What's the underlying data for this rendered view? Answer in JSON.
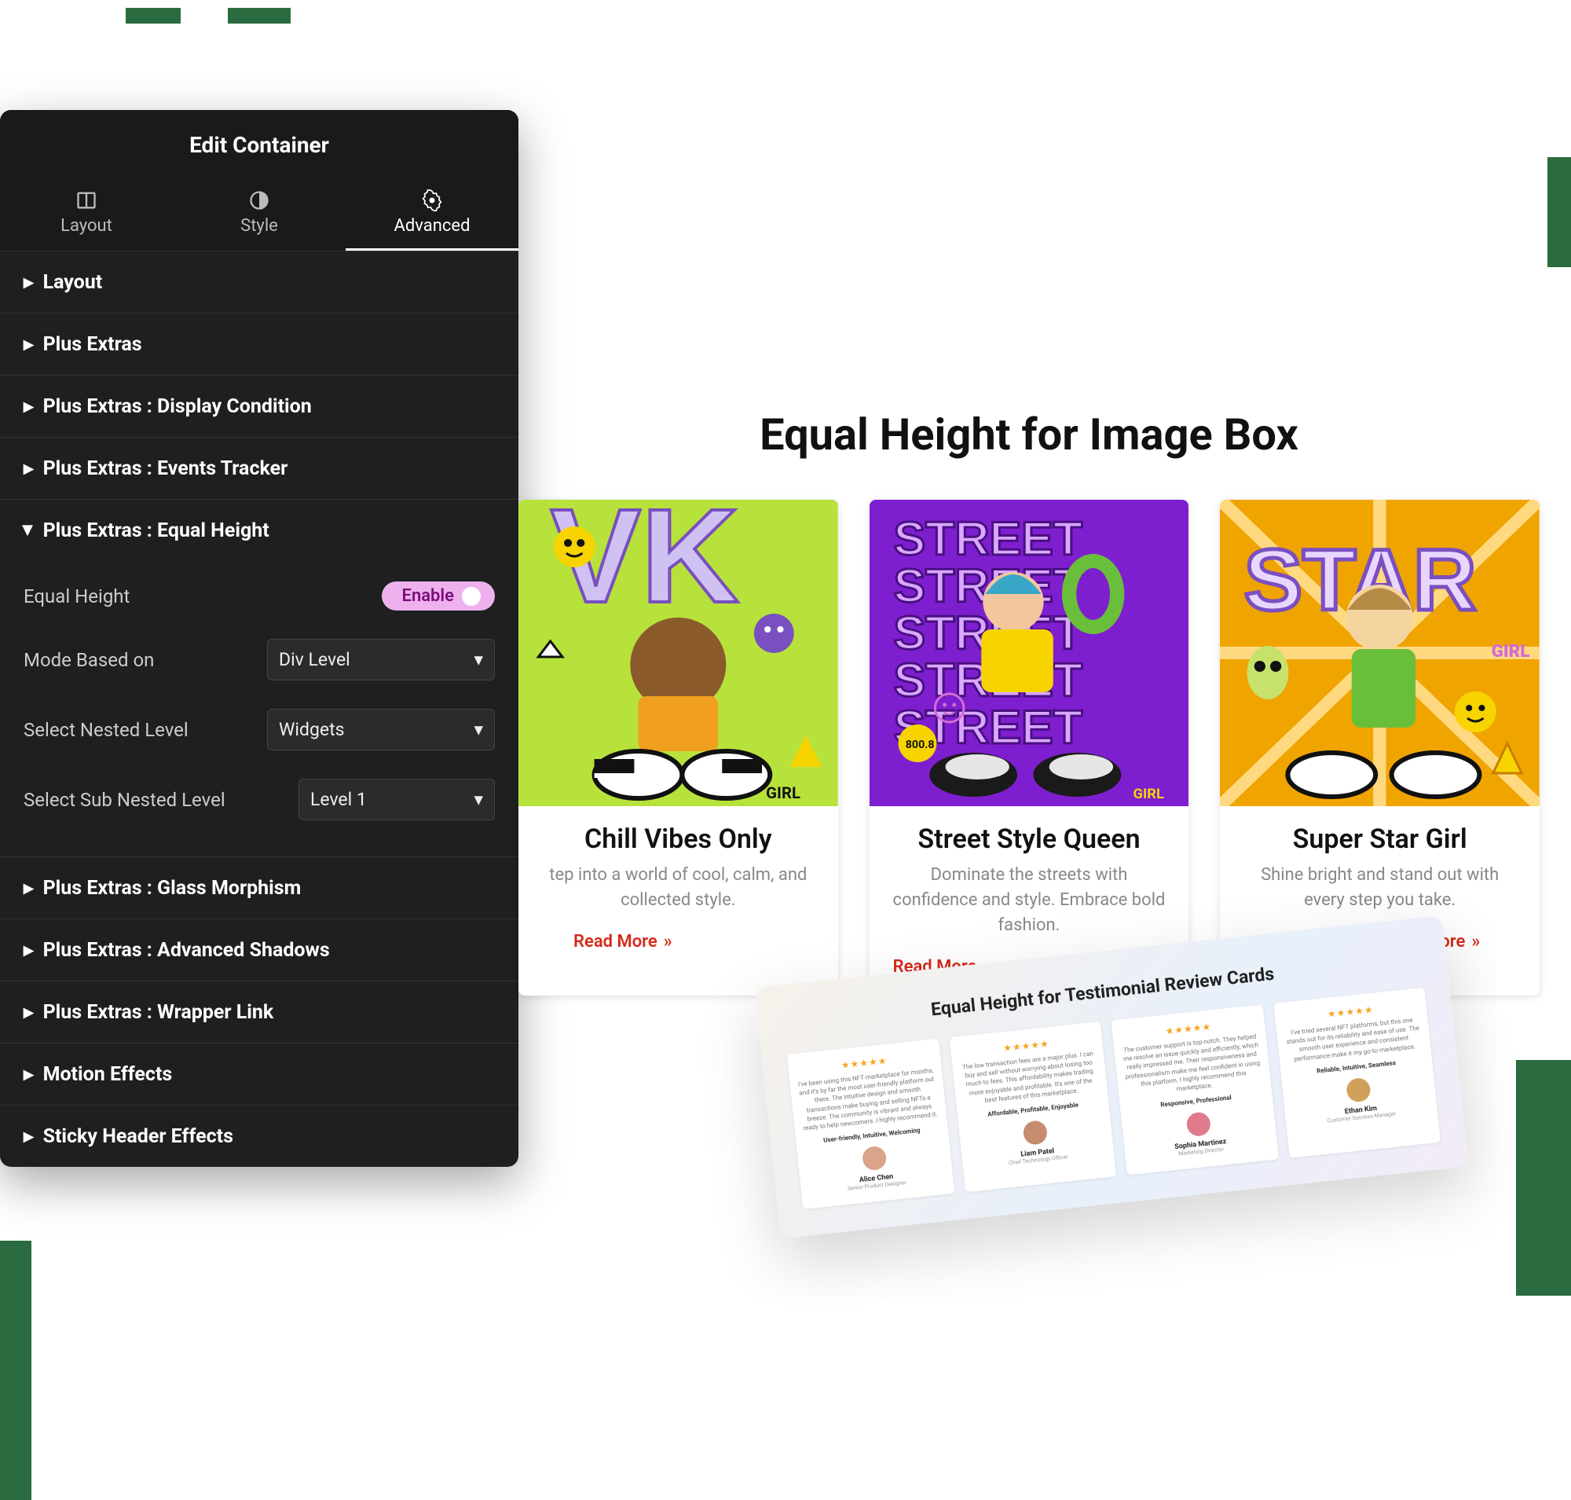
{
  "panel": {
    "title": "Edit Container",
    "tabs": [
      {
        "label": "Layout",
        "icon": "layout-icon",
        "active": false
      },
      {
        "label": "Style",
        "icon": "contrast-icon",
        "active": false
      },
      {
        "label": "Advanced",
        "icon": "gear-icon",
        "active": true
      }
    ],
    "sections": [
      {
        "label": "Layout",
        "open": false
      },
      {
        "label": "Plus Extras",
        "open": false
      },
      {
        "label": "Plus Extras : Display Condition",
        "open": false
      },
      {
        "label": "Plus Extras : Events Tracker",
        "open": false
      },
      {
        "label": "Plus Extras : Equal Height",
        "open": true,
        "fields": {
          "equal_height_label": "Equal Height",
          "equal_height_toggle": "Enable",
          "mode_label": "Mode Based on",
          "mode_value": "Div Level",
          "nested_label": "Select Nested Level",
          "nested_value": "Widgets",
          "sub_label": "Select Sub Nested Level",
          "sub_value": "Level 1"
        }
      },
      {
        "label": "Plus Extras : Glass Morphism",
        "open": false
      },
      {
        "label": "Plus Extras : Advanced Shadows",
        "open": false
      },
      {
        "label": "Plus Extras : Wrapper Link",
        "open": false
      },
      {
        "label": "Motion Effects",
        "open": false
      },
      {
        "label": "Sticky Header Effects",
        "open": false
      }
    ]
  },
  "preview": {
    "title": "Equal Height for Image Box",
    "cards": [
      {
        "title": "Chill Vibes Only",
        "desc": "tep into a world of cool, calm, and collected style.",
        "read_more": "Read More",
        "colors": {
          "bg": "#b7e23b",
          "accent": "#f0a01e"
        }
      },
      {
        "title": "Street Style Queen",
        "desc": "Dominate the streets with confidence and style. Embrace bold fashion.",
        "read_more": "Read More",
        "colors": {
          "bg": "#7e1fcf",
          "accent": "#f7d400"
        }
      },
      {
        "title": "Super Star Girl",
        "desc": "Shine bright and stand out with every step you take.",
        "read_more": "ore",
        "colors": {
          "bg": "#f0a400",
          "accent": "#6abf3a"
        }
      }
    ]
  },
  "testimonials": {
    "title": "Equal Height for Testimonial Review Cards",
    "items": [
      {
        "review": "I've been using this NFT marketplace for months, and it's by far the most user-friendly platform out there. The intuitive design and smooth transactions make buying and selling NFTs a breeze. The community is vibrant and always ready to help newcomers. I highly recommend it.",
        "traits": "User-friendly, Intuitive, Welcoming",
        "name": "Alice Chen",
        "role": "Senior Product Designer",
        "avatar": "#d9a48a"
      },
      {
        "review": "The low transaction fees are a major plus. I can buy and sell without worrying about losing too much to fees. This affordability makes trading more enjoyable and profitable. It's one of the best features of this marketplace.",
        "traits": "Affordable, Profitable, Enjoyable",
        "name": "Liam Patel",
        "role": "Chief Technology Officer",
        "avatar": "#c78b6f"
      },
      {
        "review": "The customer support is top-notch. They helped me resolve an issue quickly and efficiently, which really impressed me. Their responsiveness and professionalism make me feel confident in using this platform. I highly recommend this marketplace.",
        "traits": "Responsive, Professional",
        "name": "Sophia Martinez",
        "role": "Marketing Director",
        "avatar": "#e07b8b"
      },
      {
        "review": "I've tried several NFT platforms, but this one stands out for its reliability and ease of use. The smooth user experience and consistent performance make it my go-to marketplace.",
        "traits": "Reliable, Intuitive, Seamless",
        "name": "Ethan Kim",
        "role": "Customer Success Manager",
        "avatar": "#d1a05a"
      }
    ]
  }
}
